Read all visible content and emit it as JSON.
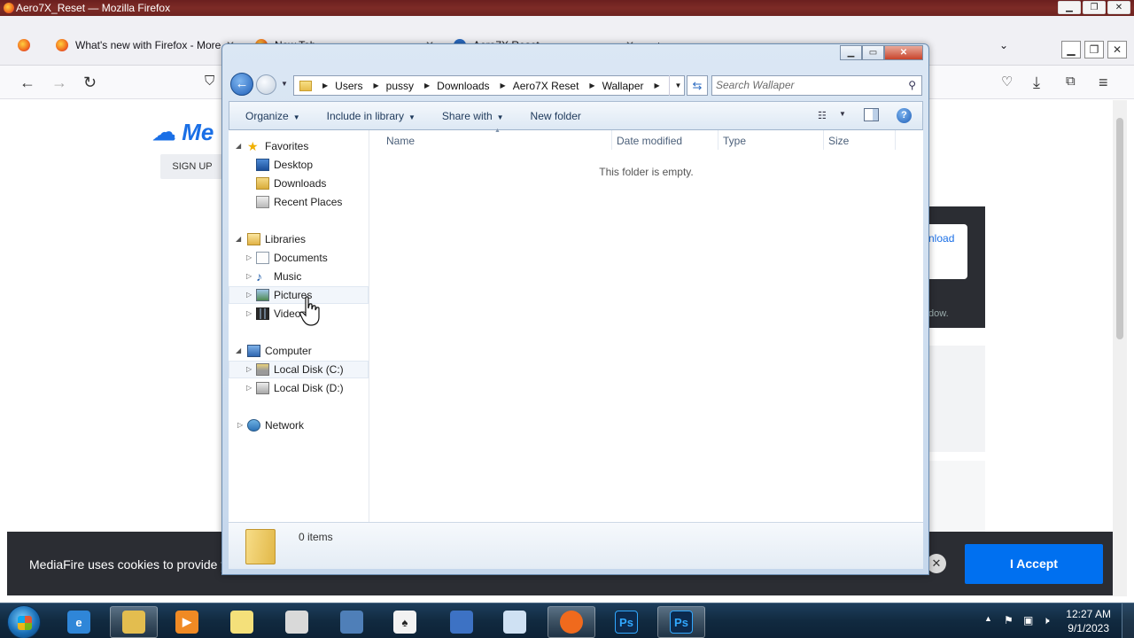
{
  "firefox": {
    "window_title": "Aero7X_Reset — Mozilla Firefox",
    "tabs": [
      {
        "label": "What's new with Firefox - More"
      },
      {
        "label": "New Tab"
      },
      {
        "label": "Aero7X Reset"
      }
    ],
    "new_tab_glyph": "+"
  },
  "page": {
    "logo_text": "Me",
    "signup_label": "SIGN UP",
    "download_partial": "nload",
    "window_hint_partial": "dow.",
    "cookie_message": "MediaFire uses cookies to provide you",
    "cookie_close": "✕",
    "accept_label": "I Accept"
  },
  "explorer": {
    "breadcrumbs": [
      "Users",
      "pussy",
      "Downloads",
      "Aero7X Reset",
      "Wallaper"
    ],
    "search_placeholder": "Search Wallaper",
    "commands": {
      "organize": "Organize",
      "include_in_library": "Include in library",
      "share_with": "Share with",
      "new_folder": "New folder"
    },
    "nav": {
      "favorites": "Favorites",
      "desktop": "Desktop",
      "downloads": "Downloads",
      "recent_places": "Recent Places",
      "libraries": "Libraries",
      "documents": "Documents",
      "music": "Music",
      "pictures": "Pictures",
      "videos": "Videos",
      "computer": "Computer",
      "local_disk_c": "Local Disk (C:)",
      "local_disk_d": "Local Disk (D:)",
      "network": "Network"
    },
    "columns": {
      "name": "Name",
      "date_modified": "Date modified",
      "type": "Type",
      "size": "Size"
    },
    "empty_message": "This folder is empty.",
    "item_count": "0 items"
  },
  "taskbar": {
    "time": "12:27 AM",
    "date": "9/1/2023",
    "apps": [
      {
        "icon": "internet-explorer-icon",
        "glyph": "e",
        "color": "#2f86d8"
      },
      {
        "icon": "file-explorer-icon",
        "glyph": "",
        "color": "#e3bd4f"
      },
      {
        "icon": "media-player-icon",
        "glyph": "▶",
        "color": "#f08a24"
      },
      {
        "icon": "sticky-notes-icon",
        "glyph": "",
        "color": "#f4e07a"
      },
      {
        "icon": "paint-icon",
        "glyph": "",
        "color": "#d9d9d9"
      },
      {
        "icon": "remote-desktop-icon",
        "glyph": "",
        "color": "#4f7fb8"
      },
      {
        "icon": "solitaire-icon",
        "glyph": "♠",
        "color": "#f2f2f2"
      },
      {
        "icon": "network-tool-icon",
        "glyph": "",
        "color": "#3d72c4"
      },
      {
        "icon": "notepad-icon",
        "glyph": "",
        "color": "#cfe1f3"
      },
      {
        "icon": "firefox-icon",
        "glyph": "",
        "color": "#f06a1d"
      },
      {
        "icon": "photoshop-shield-icon",
        "glyph": "Ps",
        "color": "#0c2a4e"
      },
      {
        "icon": "photoshop-icon",
        "glyph": "Ps",
        "color": "#0c2a4e"
      }
    ]
  }
}
